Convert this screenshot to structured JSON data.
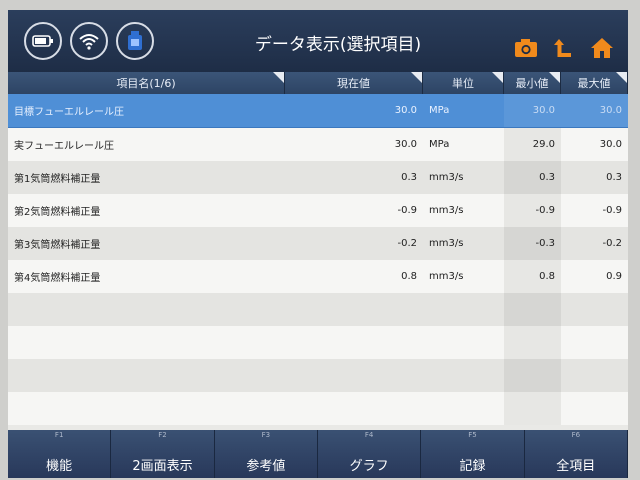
{
  "header": {
    "title": "データ表示(選択項目)",
    "left_icons": [
      "battery-icon",
      "wifi-icon",
      "vci-connector-icon"
    ],
    "right_icons": [
      "camera-icon",
      "back-arrow-icon",
      "home-icon"
    ]
  },
  "table": {
    "columns": [
      "項目名(1/6)",
      "現在値",
      "単位",
      "最小値",
      "最大値"
    ],
    "rows": [
      {
        "name": "目標フューエルレール圧",
        "value": "30.0",
        "unit": "MPa",
        "min": "30.0",
        "max": "30.0"
      },
      {
        "name": "実フューエルレール圧",
        "value": "30.0",
        "unit": "MPa",
        "min": "29.0",
        "max": "30.0"
      },
      {
        "name": "第1気筒燃料補正量",
        "value": "0.3",
        "unit": "mm3/s",
        "min": "0.3",
        "max": "0.3"
      },
      {
        "name": "第2気筒燃料補正量",
        "value": "-0.9",
        "unit": "mm3/s",
        "min": "-0.9",
        "max": "-0.9"
      },
      {
        "name": "第3気筒燃料補正量",
        "value": "-0.2",
        "unit": "mm3/s",
        "min": "-0.3",
        "max": "-0.2"
      },
      {
        "name": "第4気筒燃料補正量",
        "value": "0.8",
        "unit": "mm3/s",
        "min": "0.8",
        "max": "0.9"
      }
    ],
    "selected_index": 0
  },
  "function_keys": [
    {
      "key": "F1",
      "label": "機能"
    },
    {
      "key": "F2",
      "label": "2画面表示"
    },
    {
      "key": "F3",
      "label": "参考値"
    },
    {
      "key": "F4",
      "label": "グラフ"
    },
    {
      "key": "F5",
      "label": "記録"
    },
    {
      "key": "F6",
      "label": "全項目"
    }
  ],
  "colors": {
    "header_bg": "#1e2d46",
    "selected_row": "#4f8fd6",
    "accent_orange": "#f08a1c"
  }
}
